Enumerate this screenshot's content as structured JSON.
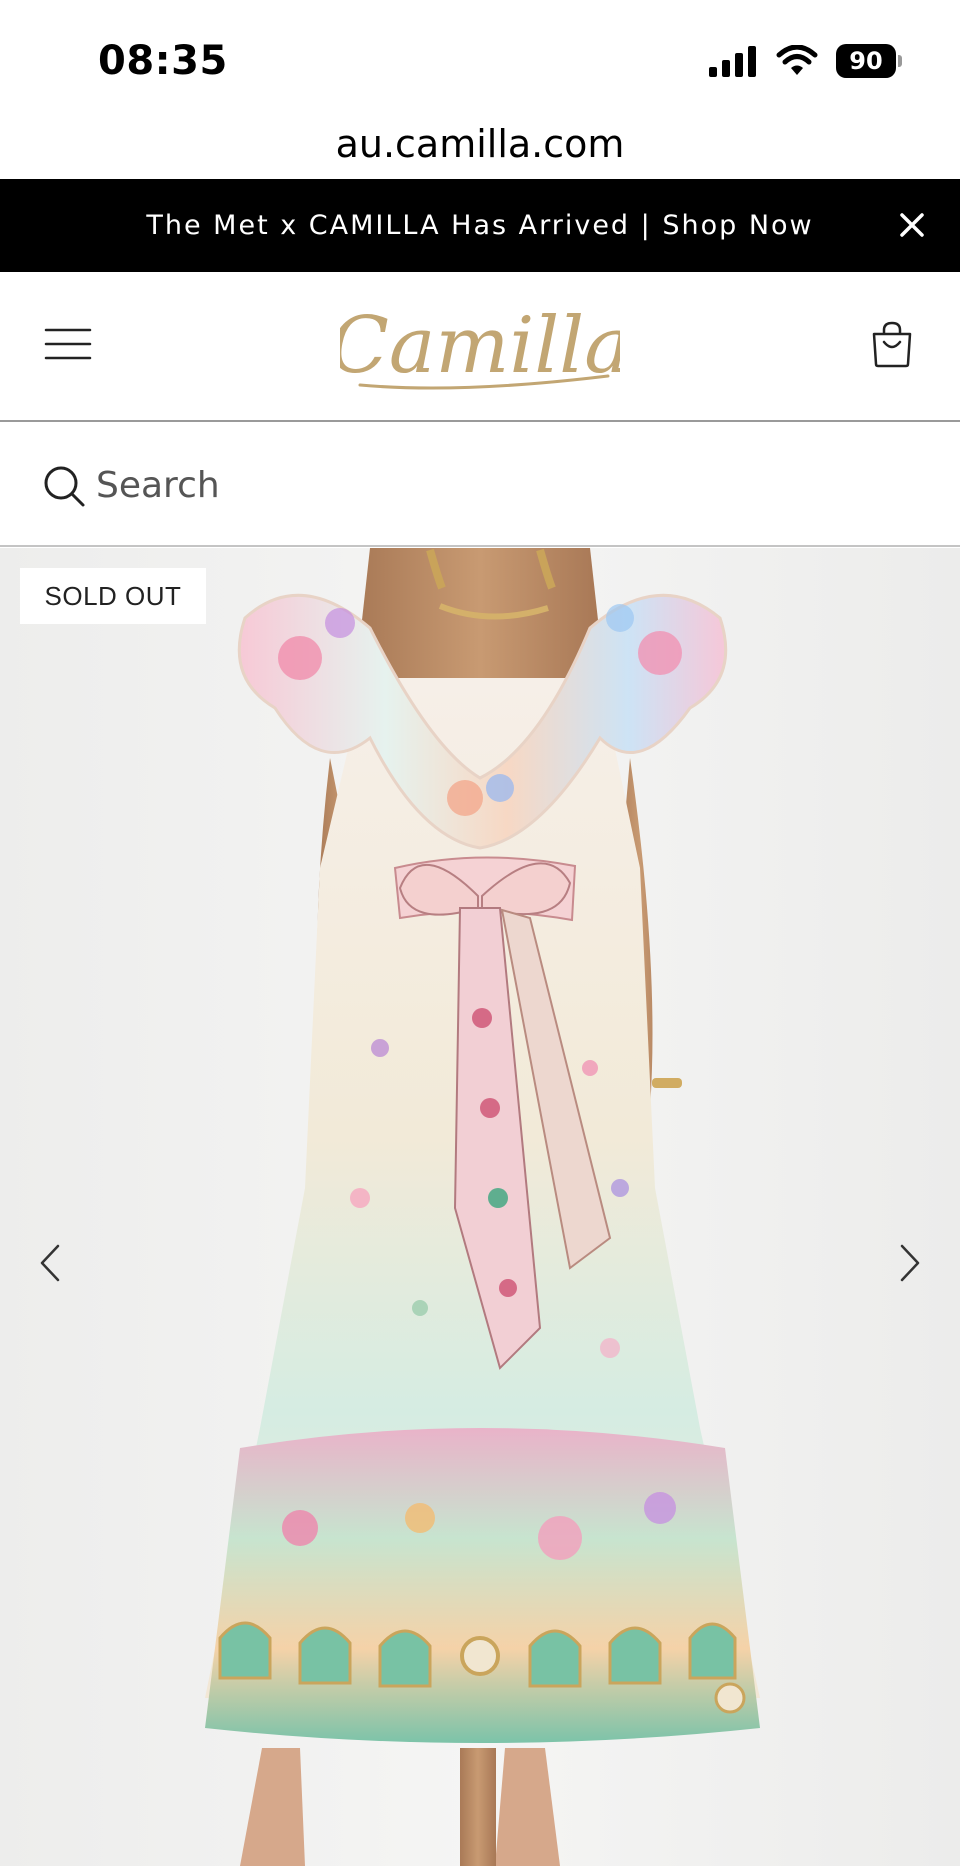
{
  "status_bar": {
    "time": "08:35",
    "battery": "90",
    "icons": [
      "cellular-signal-icon",
      "wifi-icon",
      "battery-icon"
    ]
  },
  "browser": {
    "url": "au.camilla.com"
  },
  "promo_banner": {
    "text": "The Met x CAMILLA Has Arrived | Shop Now",
    "close_icon": "close-icon",
    "background": "#000000",
    "text_color": "#ffffff"
  },
  "header": {
    "brand": "Camilla",
    "brand_color": "#c2a673",
    "menu_icon": "hamburger-menu-icon",
    "cart_icon": "shopping-bag-icon"
  },
  "search": {
    "placeholder": "Search",
    "icon": "search-icon"
  },
  "product_gallery": {
    "badge": "SOLD OUT",
    "prev_icon": "chevron-left-icon",
    "next_icon": "chevron-right-icon",
    "image": "floral-maxi-dress-back-view"
  }
}
